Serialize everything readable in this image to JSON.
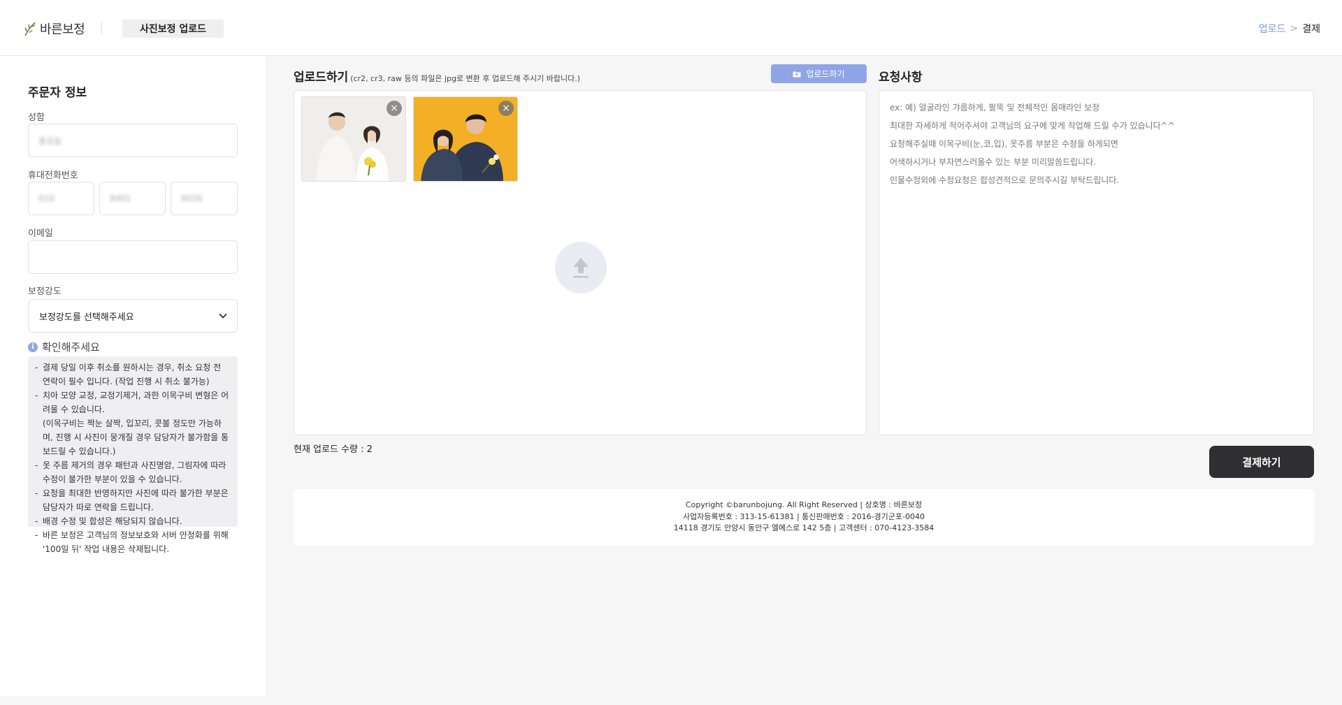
{
  "header": {
    "logo_text": "바른보정",
    "active_tab": "사진보정 업로드",
    "breadcrumb": {
      "upload": "업로드",
      "separator": ">",
      "payment": "결제"
    }
  },
  "sidebar": {
    "title": "주문자 정보",
    "name": {
      "label": "성함",
      "value": "홍길동"
    },
    "phone": {
      "label": "휴대전화번호",
      "part1": "010",
      "part2": "8401",
      "part3": "6026"
    },
    "email": {
      "label": "이메일",
      "value": ""
    },
    "strength": {
      "label": "보정강도",
      "selected": "보정강도를 선택해주세요"
    },
    "notice": {
      "title": "확인해주세요",
      "items": [
        "결제 당일 이후 취소를 원하시는 경우, 취소 요청 전 연락이 필수 입니다. (작업 진행 시 취소 불가능)",
        "치아 모양 교정, 교정기제거, 과한 이목구비 변형은 어려울 수 있습니다.\n(이목구비는 짝눈 살짝, 입꼬리, 콧볼 정도만 가능하며, 진행 시 사진이 뭉개질 경우 담당자가 불가함을 통보드릴 수 있습니다.)",
        "옷 주름 제거의 경우 패턴과 사진명암, 그림자에 따라 수정이 불가한 부분이 있을 수 있습니다.",
        "요청을 최대한 반영하지만 사진에 따라 불가한 부분은 담당자가 따로 연락을 드립니다.",
        "배경 수정 및 합성은 해당되지 않습니다.",
        "바른 보정은 고객님의 정보보호와 서버 안정화를 위해 '100일 뒤' 작업 내용은 삭제됩니다."
      ]
    }
  },
  "upload": {
    "title": "업로드하기",
    "subtitle": "(cr2, cr3, raw 등의 파일은 jpg로 변환 후 업로드해 주시기 바랍니다.)",
    "button_label": "업로드하기",
    "count_text": "현재 업로드 수량 : 2",
    "remove_symbol": "×"
  },
  "request": {
    "title": "요청사항",
    "placeholder_lines": [
      "ex: 예) 얼굴라인 갸름하게, 팔뚝 및 전체적인 몸매라인 보정",
      "최대한 자세하게 적어주셔야 고객님의 요구에 맞게 작업해 드릴 수가 있습니다^^",
      "요청해주실때 이목구비(눈,코,입), 옷주름 부분은 수정을 하게되면",
      "어색하시거나 부자연스러울수 있는 부분 미리말씀드립니다.",
      "인물수정외에 수정요청은 합성견적으로 문의주시길 부탁드립니다."
    ]
  },
  "pay_button": "결제하기",
  "footer": {
    "line1": "Copyright ©barunbojung. All Right Reserved | 상호명 : 바른보정",
    "line2": "사업자등록번호 : 313-15-61381 | 통신판매번호 : 2016-경기군포-0040",
    "line3": "14118 경기도 안양시 동안구 엘에스로 142 5층 | 고객센터 : 070-4123-3584"
  },
  "colors": {
    "accent": "#8fa5e6",
    "dark_button": "#2f2f31",
    "photo2_background": "#f3b026"
  }
}
